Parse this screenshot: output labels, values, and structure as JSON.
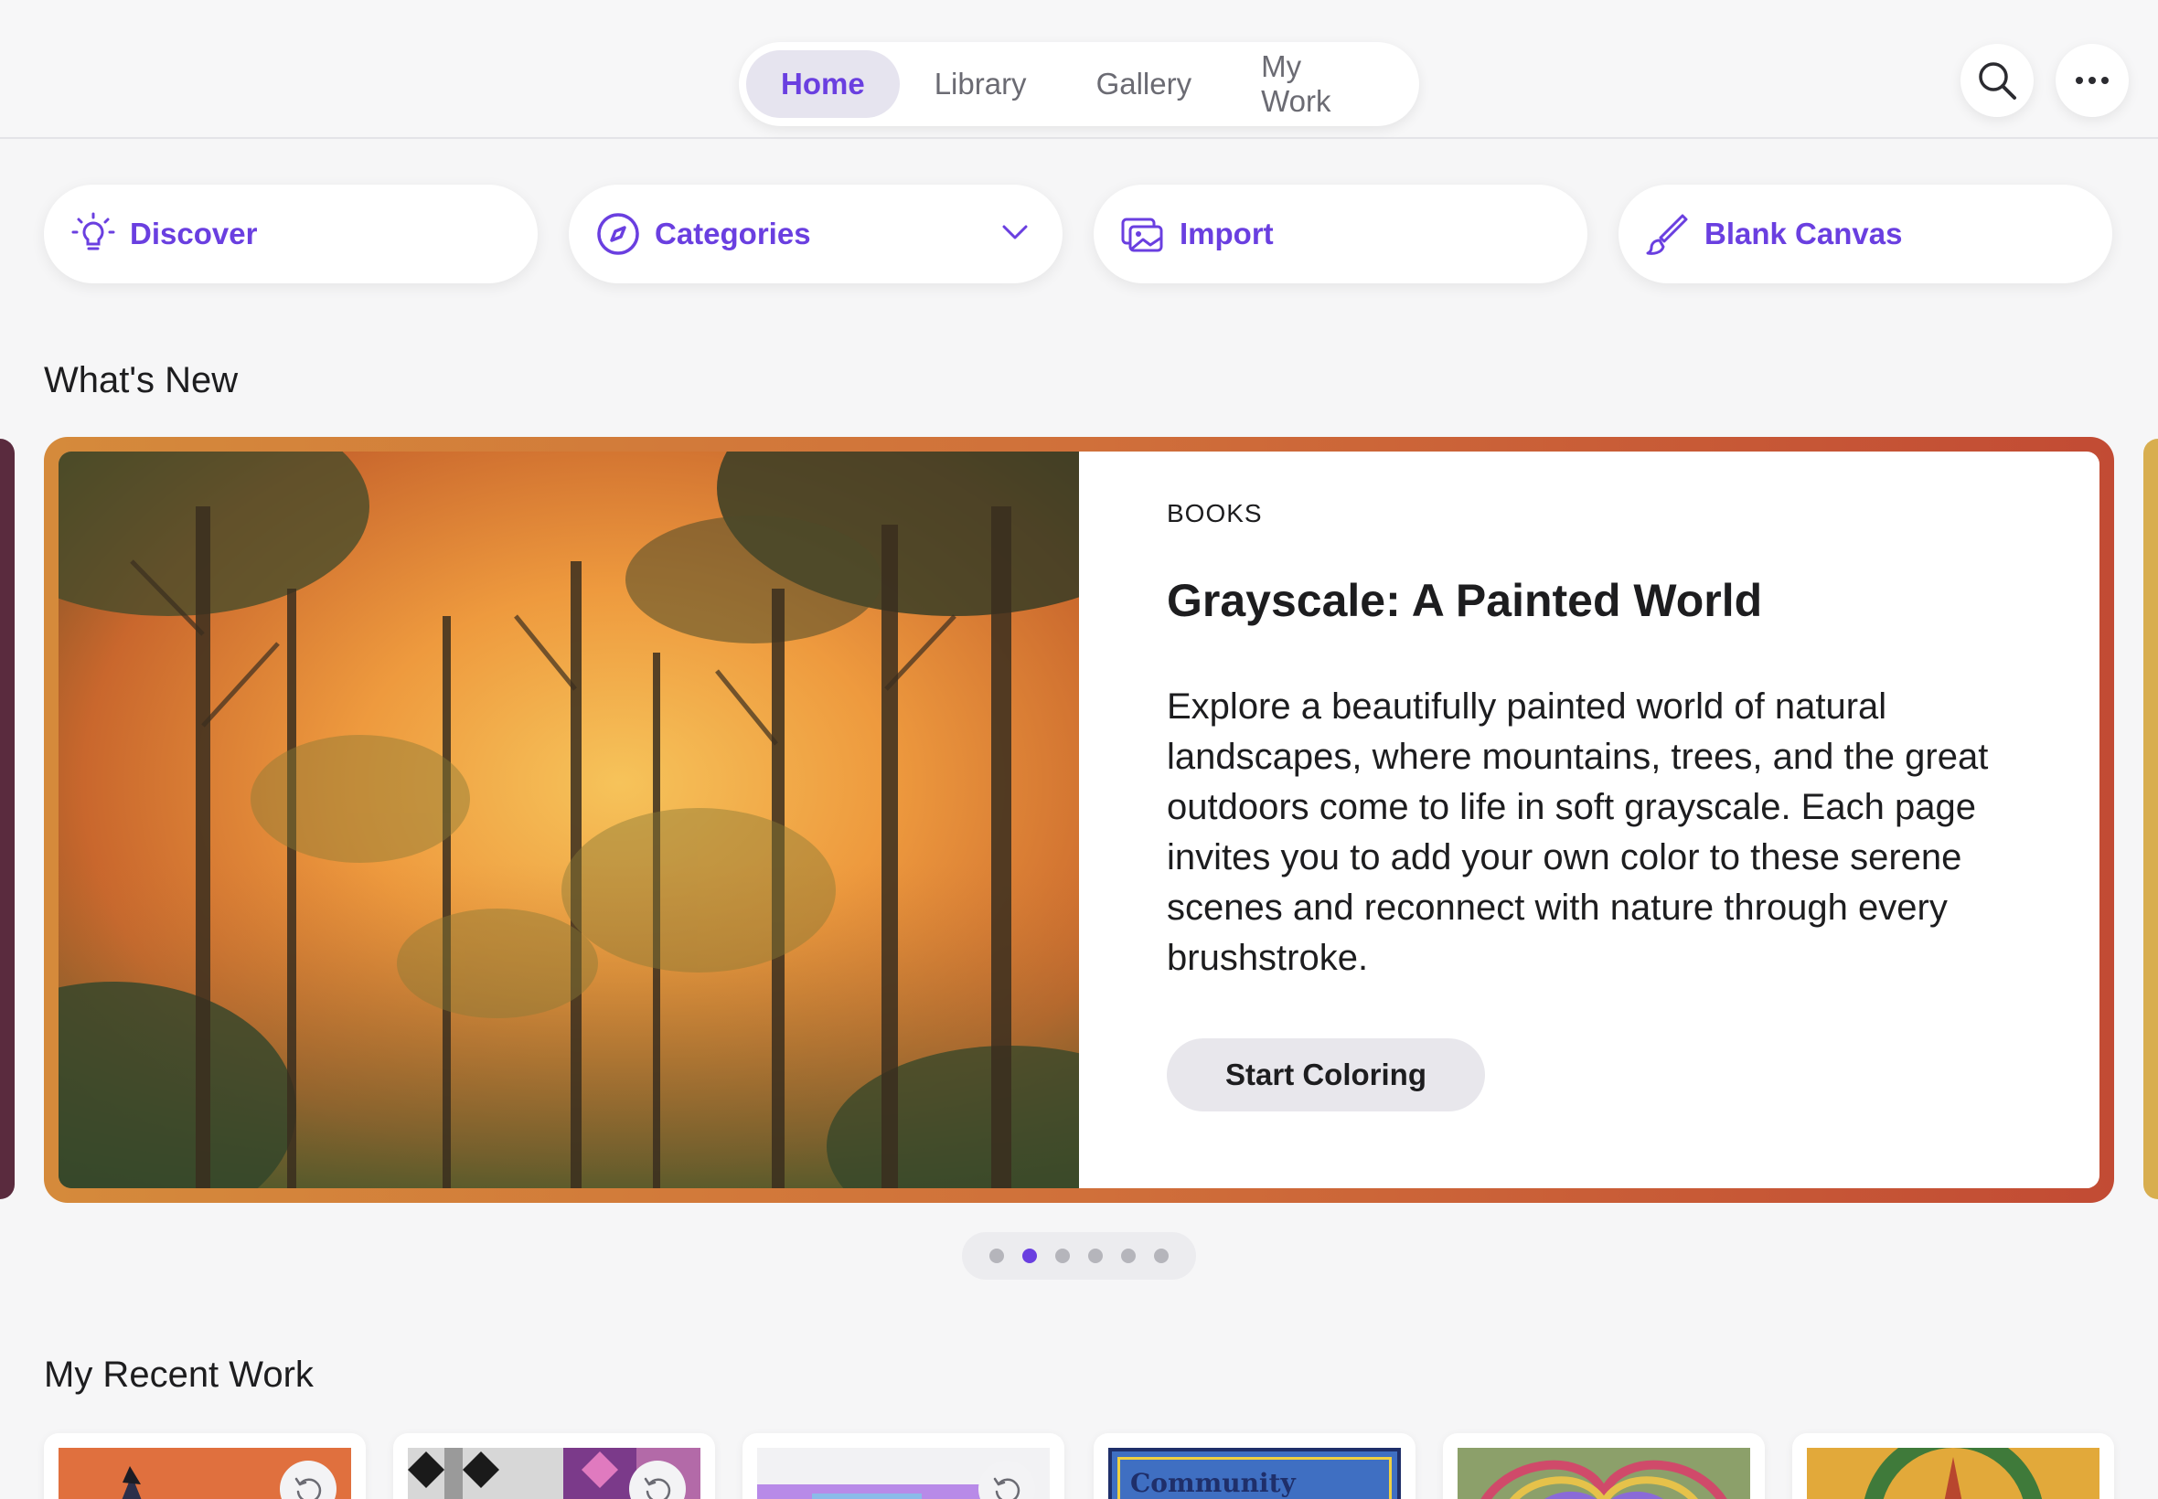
{
  "nav": {
    "tabs": [
      {
        "label": "Home",
        "active": true
      },
      {
        "label": "Library",
        "active": false
      },
      {
        "label": "Gallery",
        "active": false
      },
      {
        "label": "My Work",
        "active": false
      }
    ],
    "search_icon": "search-icon",
    "more_icon": "more-horizontal-icon"
  },
  "actions": {
    "discover": {
      "label": "Discover",
      "icon": "lightbulb-icon"
    },
    "categories": {
      "label": "Categories",
      "icon": "compass-icon"
    },
    "import": {
      "label": "Import",
      "icon": "images-icon"
    },
    "blank_canvas": {
      "label": "Blank Canvas",
      "icon": "paintbrush-icon"
    }
  },
  "whats_new": {
    "title": "What's New",
    "featured": {
      "category": "BOOKS",
      "title": "Grayscale: A Painted World",
      "description": "Explore a beautifully painted world of natural landscapes, where mountains, trees, and the great outdoors come to life in soft grayscale. Each page invites you to add your own color to these serene scenes and reconnect with nature through every brushstroke.",
      "cta": "Start Coloring"
    },
    "pager": {
      "count": 6,
      "active_index": 1
    }
  },
  "recent_work": {
    "title": "My Recent Work",
    "items": [
      {
        "thumb_text": "",
        "has_undo": true
      },
      {
        "thumb_text": "",
        "has_undo": true
      },
      {
        "thumb_text": "",
        "has_undo": true
      },
      {
        "thumb_text": "Community",
        "has_undo": false
      },
      {
        "thumb_text": "",
        "has_undo": false
      },
      {
        "thumb_text": "",
        "has_undo": false
      }
    ]
  },
  "colors": {
    "accent": "#6a3fe0",
    "hero_border_start": "#d58a3b",
    "hero_border_end": "#c24b34",
    "background": "#f6f6f7"
  }
}
